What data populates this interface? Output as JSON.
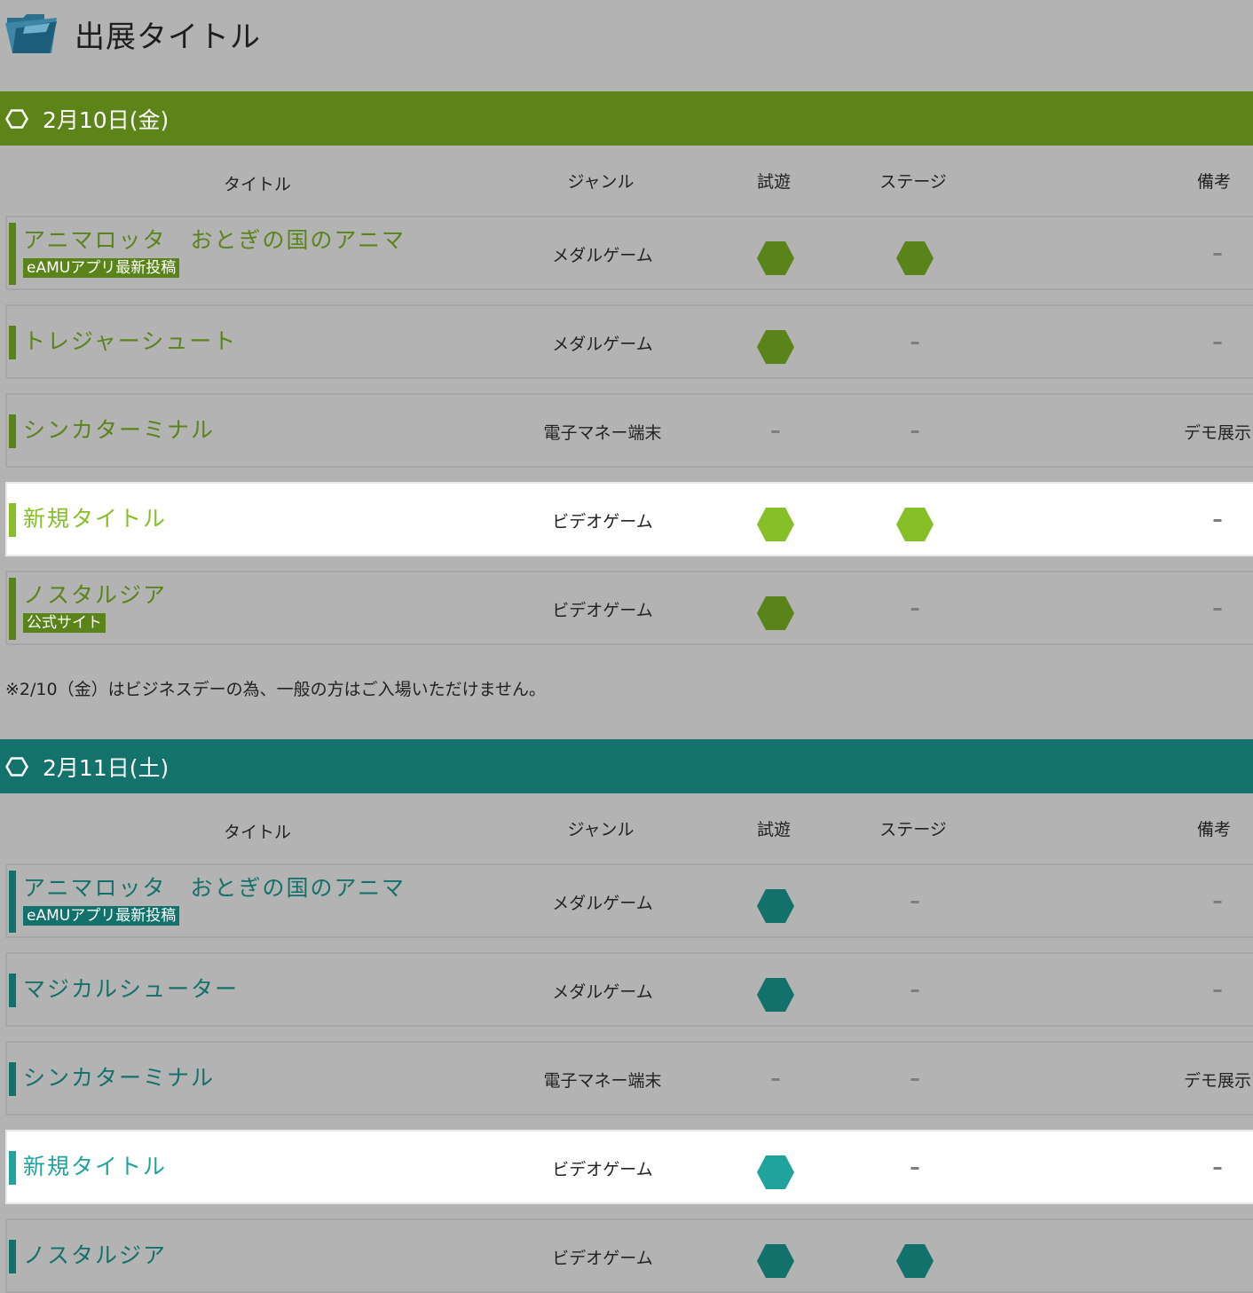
{
  "page": {
    "title": "出展タイトル"
  },
  "columns": {
    "title": "タイトル",
    "genre": "ジャンル",
    "play": "試遊",
    "stage": "ステージ",
    "note": "備考"
  },
  "days": [
    {
      "label": "2月10日(金)",
      "color": "#5c8418",
      "dark": "#5a841a",
      "light": "#86bf27",
      "rows": [
        {
          "title": "アニマロッタ　おとぎの国のアニマ",
          "badge": "eAMUアプリ最新投稿",
          "genre": "メダルゲーム",
          "play": "dark",
          "stage": "dark",
          "note": "-",
          "highlight": false
        },
        {
          "title": "トレジャーシュート",
          "badge": "",
          "genre": "メダルゲーム",
          "play": "dark",
          "stage": "-",
          "note": "-",
          "highlight": false
        },
        {
          "title": "シンカターミナル",
          "badge": "",
          "genre": "電子マネー端末",
          "play": "-",
          "stage": "-",
          "note": "デモ展示",
          "highlight": false
        },
        {
          "title": "新規タイトル",
          "badge": "",
          "genre": "ビデオゲーム",
          "play": "light",
          "stage": "light",
          "note": "-",
          "highlight": true
        },
        {
          "title": "ノスタルジア",
          "badge": "公式サイト",
          "genre": "ビデオゲーム",
          "play": "dark",
          "stage": "-",
          "note": "-",
          "highlight": false
        }
      ],
      "notice": "※2/10（金）はビジネスデーの為、一般の方はご入場いただけません。"
    },
    {
      "label": "2月11日(土)",
      "color": "#13726b",
      "dark": "#13716b",
      "light": "#1fa39c",
      "rows": [
        {
          "title": "アニマロッタ　おとぎの国のアニマ",
          "badge": "eAMUアプリ最新投稿",
          "genre": "メダルゲーム",
          "play": "dark",
          "stage": "-",
          "note": "-",
          "highlight": false
        },
        {
          "title": "マジカルシューター",
          "badge": "",
          "genre": "メダルゲーム",
          "play": "dark",
          "stage": "-",
          "note": "-",
          "highlight": false
        },
        {
          "title": "シンカターミナル",
          "badge": "",
          "genre": "電子マネー端末",
          "play": "-",
          "stage": "-",
          "note": "デモ展示",
          "highlight": false
        },
        {
          "title": "新規タイトル",
          "badge": "",
          "genre": "ビデオゲーム",
          "play": "light",
          "stage": "-",
          "note": "-",
          "highlight": true
        },
        {
          "title": "ノスタルジア",
          "badge": "",
          "genre": "ビデオゲーム",
          "play": "dark",
          "stage": "dark",
          "note": "",
          "highlight": false
        }
      ],
      "notice": ""
    }
  ]
}
